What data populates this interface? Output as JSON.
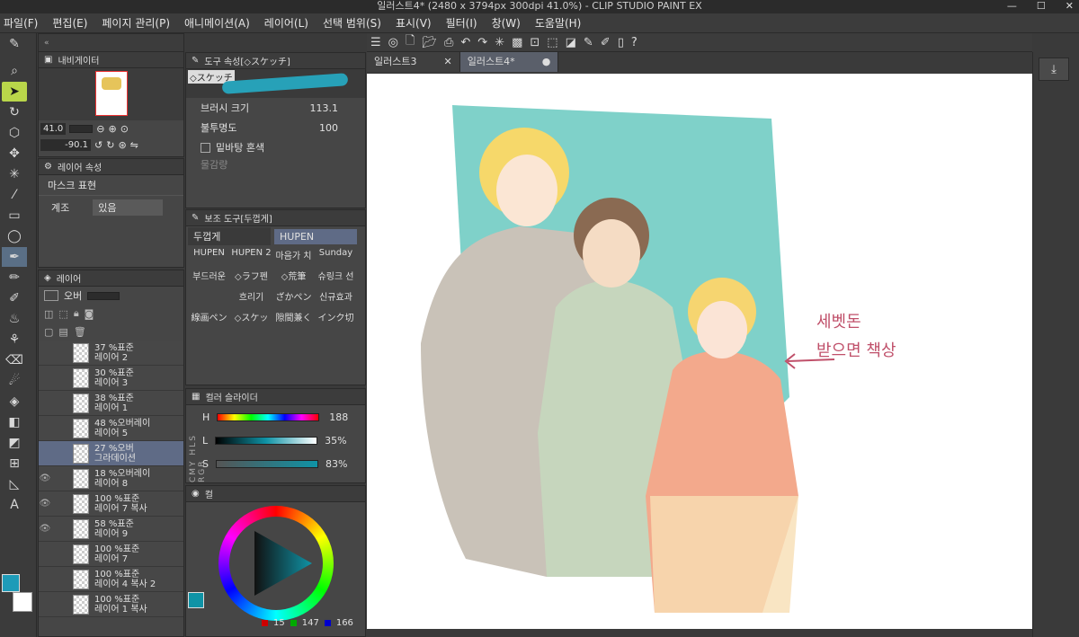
{
  "window": {
    "title": "일러스트4* (2480 x 3794px 300dpi 41.0%)  - CLIP STUDIO PAINT EX"
  },
  "menu": [
    "파일(F)",
    "편집(E)",
    "페이지 관리(P)",
    "애니메이션(A)",
    "레이어(L)",
    "선택 범위(S)",
    "표시(V)",
    "필터(I)",
    "창(W)",
    "도움말(H)"
  ],
  "navigator": {
    "title": "내비게이터",
    "zoom": "41.0",
    "rotation": "-90.1"
  },
  "layer_property": {
    "title": "레이어 속성",
    "section": "마스크 표현",
    "label": "계조",
    "value": "있음"
  },
  "tool_property": {
    "title": "도구 속성[◇スケッチ]",
    "brush_name": "◇スケッチ",
    "brush_size_label": "브러시 크기",
    "brush_size": "113.1",
    "opacity_label": "불투명도",
    "opacity": "100",
    "underlay_label": "밑바탕 혼색",
    "blend_label": "물감량"
  },
  "sub_tool": {
    "title": "보조 도구[두껍게]",
    "tabs": [
      "두껍게",
      "HUPEN"
    ],
    "brushes": [
      "HUPEN",
      "HUPEN 2",
      "마음가 치",
      "Sunday",
      "부드러운",
      "◇ラフ펜",
      "◇荒筆",
      "슈링크 선",
      "",
      "흐리기",
      "ざかペン",
      "신규효과",
      "線画ペン",
      "◇スケッ",
      "隙間兼く",
      "インク切"
    ]
  },
  "layers": {
    "title": "레이어",
    "blend": "오버",
    "rows": [
      {
        "line1": "37 %표준",
        "line2": "레이어 2",
        "visible": false
      },
      {
        "line1": "30 %표준",
        "line2": "레이어 3",
        "visible": false
      },
      {
        "line1": "38 %표준",
        "line2": "레이어 1",
        "visible": false
      },
      {
        "line1": "48 %오버레이",
        "line2": "레이어 5",
        "visible": false
      },
      {
        "line1": "27 %오버",
        "line2": "그라데이션",
        "visible": false
      },
      {
        "line1": "18 %오버레이",
        "line2": "레이어 8",
        "visible": true
      },
      {
        "line1": "100 %표준",
        "line2": "레이어 7 복사",
        "visible": true
      },
      {
        "line1": "58 %표준",
        "line2": "레이어 9",
        "visible": true
      },
      {
        "line1": "100 %표준",
        "line2": "레이어 7",
        "visible": false
      },
      {
        "line1": "100 %표준",
        "line2": "레이어 4 복사 2",
        "visible": false
      },
      {
        "line1": "100 %표준",
        "line2": "레이어 1 복사",
        "visible": false
      }
    ]
  },
  "color_slider": {
    "title": "컬러 슬라이더",
    "h_label": "H",
    "h": "188",
    "l_label": "L",
    "l": "35%",
    "s_label": "S",
    "s": "83%",
    "side_labels": [
      "RGB",
      "HLS",
      "CMY"
    ]
  },
  "color_wheel": {
    "title": "컬",
    "r": "15",
    "g": "147",
    "b": "166"
  },
  "colors": {
    "main": "#0f93a6",
    "accent": "#b9d64a"
  },
  "tabs": {
    "doc1": "일러스트3",
    "doc2": "일러스트4*"
  },
  "artwork": {
    "note_line1": "세벳돈",
    "note_line2": "받으면 책상"
  }
}
